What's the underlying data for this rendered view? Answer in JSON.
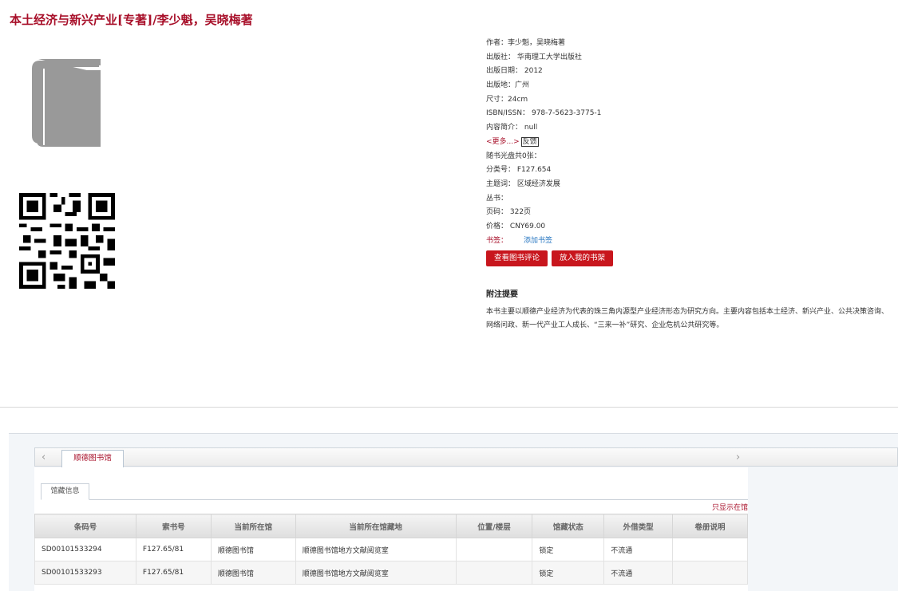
{
  "title": "本土经济与新兴产业[专著]/李少魁，吴晓梅著",
  "info": {
    "author": "作者：李少魁，吴晓梅著",
    "publisher": "出版社：  华南理工大学出版社",
    "pub_date": "出版日期：  2012",
    "pub_place": "出版地：广州",
    "size": "尺寸：24cm",
    "isbn": "ISBN/ISSN：  978-7-5623-3775-1",
    "summary": "内容简介：  null",
    "more": "<更多...>",
    "feedback": "反馈",
    "cd": "随书光盘共0张：",
    "class_no": "分类号：  F127.654",
    "subject": "主题词：  区域经济发展",
    "series": "丛书：",
    "pages": "页码：  322页",
    "price": "价格：  CNY69.00",
    "tag_label": "书签：",
    "tag_add": "添加书签"
  },
  "buttons": {
    "view_reviews": "查看图书评论",
    "add_shelf": "放入我的书架"
  },
  "note": {
    "heading": "附注提要",
    "body": "本书主要以顺德产业经济为代表的珠三角内源型产业经济形态为研究方向。主要内容包括本土经济、新兴产业、公共决策咨询、网络问政、新一代产业工人成长、“三来一补”研究、企业危机公共研究等。"
  },
  "holdings": {
    "tab_label": "顺德图书馆",
    "subtab_label": "馆藏信息",
    "only_show": "只显示在馆",
    "columns": [
      "条码号",
      "索书号",
      "当前所在馆",
      "当前所在馆藏地",
      "位置/楼层",
      "馆藏状态",
      "外借类型",
      "卷册说明"
    ],
    "rows": [
      [
        "SD00101533294",
        "F127.65/81",
        "顺德图书馆",
        "顺德图书馆地方文献阅览室",
        "",
        "锁定",
        "不流通",
        ""
      ],
      [
        "SD00101533293",
        "F127.65/81",
        "顺德图书馆",
        "顺德图书馆地方文献阅览室",
        "",
        "锁定",
        "不流通",
        ""
      ]
    ]
  },
  "colors": {
    "accent": "#a8102a",
    "button": "#c8161d",
    "link": "#2a78c2"
  },
  "icons": {
    "cover": "book-icon",
    "code": "qr-code-icon",
    "prev": "chevron-left-icon",
    "next": "chevron-right-icon"
  }
}
